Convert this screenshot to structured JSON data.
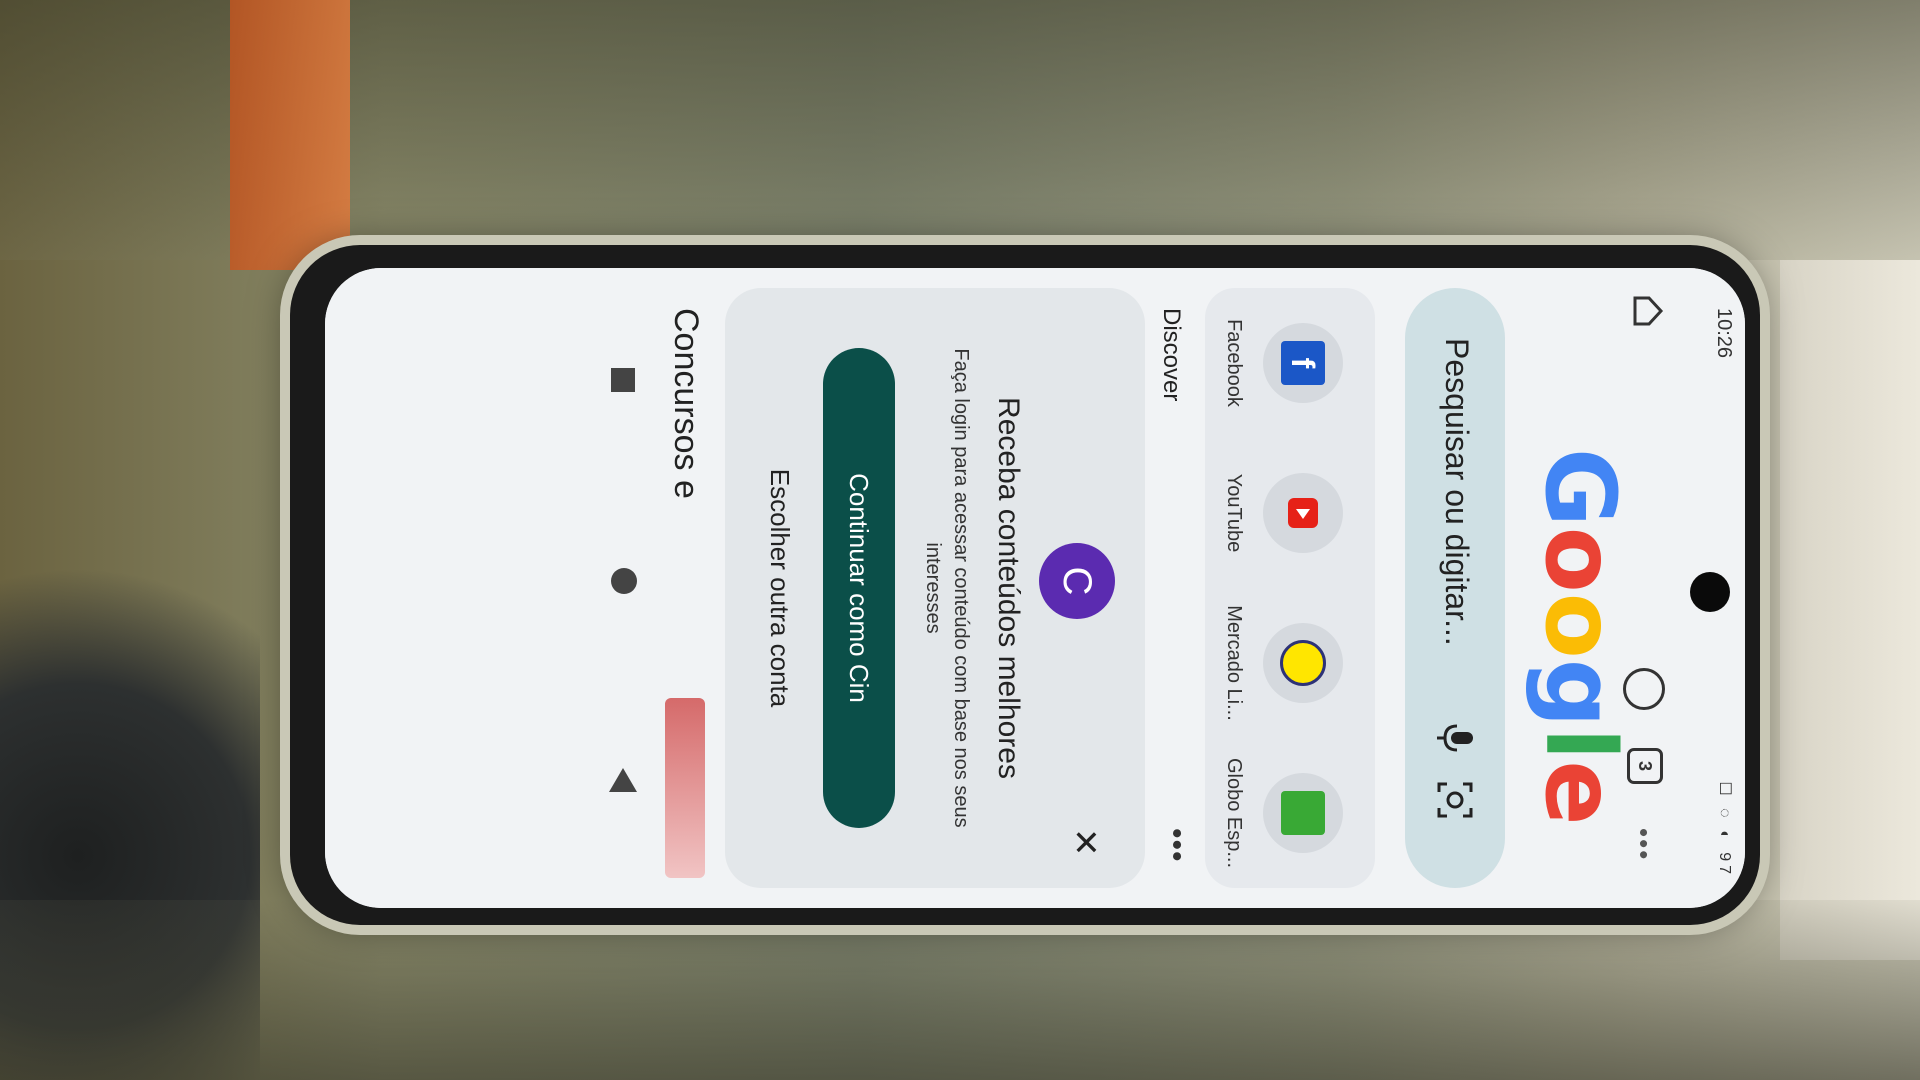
{
  "status_bar": {
    "time": "10:26",
    "icons": "☐ ◌ ◐",
    "battery": "97"
  },
  "header": {
    "tabs_count": "3",
    "menu": "•••"
  },
  "logo": {
    "letters": [
      "G",
      "o",
      "o",
      "g",
      "l",
      "e"
    ],
    "colors": [
      "#4285F4",
      "#EA4335",
      "#FBBC05",
      "#4285F4",
      "#34A853",
      "#EA4335"
    ]
  },
  "search": {
    "placeholder": "Pesquisar ou digitar..."
  },
  "shortcuts": [
    {
      "label": "Facebook",
      "icon": "facebook-icon"
    },
    {
      "label": "YouTube",
      "icon": "youtube-icon"
    },
    {
      "label": "Mercado Li...",
      "icon": "mercado-livre-icon"
    },
    {
      "label": "Globo Esp...",
      "icon": "globo-esporte-icon"
    }
  ],
  "discover": {
    "label": "Discover",
    "more": "•••",
    "avatar_letter": "C",
    "close": "✕",
    "title": "Receba conteúdos melhores",
    "description": "Faça login para acessar conteúdo com base nos seus interesses",
    "continue_button": "Continuar como Cin",
    "other_account": "Escolher outra conta"
  },
  "feed": {
    "first_title": "Concursos e"
  },
  "colors": {
    "accent": "#0b4f49",
    "avatar": "#5b2bb0",
    "search_bg": "#cfe0e4"
  }
}
